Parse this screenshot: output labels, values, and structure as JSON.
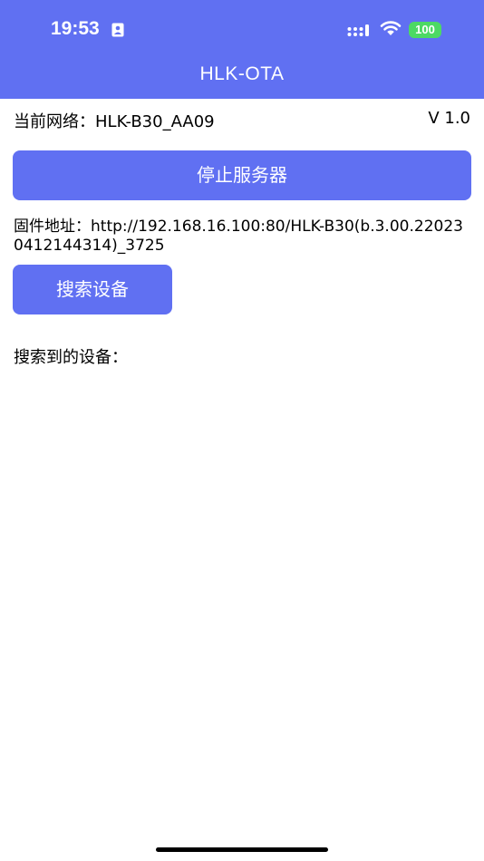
{
  "status_bar": {
    "time": "19:53",
    "battery": "100",
    "icons": [
      "contact-card-icon",
      "cellular-signal-icon",
      "wifi-icon",
      "battery-icon"
    ]
  },
  "header": {
    "title": "HLK-OTA"
  },
  "network": {
    "label": "当前网络：",
    "ssid": "HLK-B30_AA09",
    "version": "V 1.0"
  },
  "buttons": {
    "stop_server": "停止服务器",
    "search_devices": "搜索设备"
  },
  "firmware": {
    "label": "固件地址：",
    "url": "http://192.168.16.100:80/HLK-B30(b.3.00.220230412144314)_3725"
  },
  "devices": {
    "label": "搜索到的设备：",
    "items": []
  },
  "colors": {
    "primary": "#6070f2",
    "battery": "#4cd964",
    "background": "#ffffff"
  }
}
